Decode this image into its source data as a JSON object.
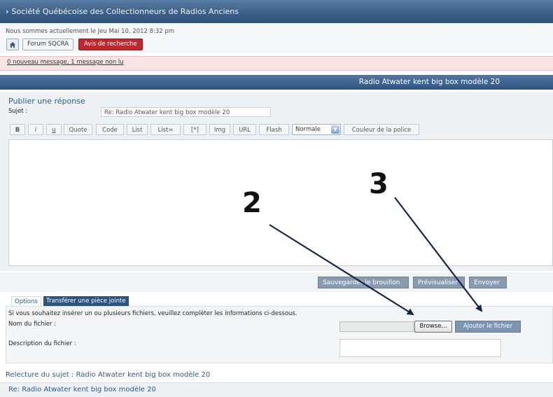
{
  "header": {
    "site_title": "Société Québécoise des Collectionneurs de Radios Anciens"
  },
  "nav": {
    "date_text": "Nous sommes actuellement le Jeu Mai 10, 2012 8:32 pm",
    "home_icon": "home-icon",
    "forum_label": "Forum SQCRA",
    "search_label": "Avis de recherche"
  },
  "notice": {
    "text": "0 nouveau message, 1 message non lu"
  },
  "topic": {
    "title": "Radio Atwater kent big box modèle 20"
  },
  "post": {
    "heading": "Publier une réponse",
    "subject_label": "Sujet :",
    "subject_value": "Re: Radio Atwater kent big box modèle 20",
    "toolbar": [
      "B",
      "i",
      "u",
      "Quote",
      "Code",
      "List",
      "List=",
      "[*]",
      "Img",
      "URL",
      "Flash"
    ],
    "font_size_value": "Normale",
    "font_color_label": "Couleur de la police",
    "message": ""
  },
  "actions": {
    "save_draft": "Sauvegarder le brouillon",
    "preview": "Prévisualiser",
    "submit": "Envoyer"
  },
  "tabs": {
    "options": "Options",
    "attach": "Transférer une pièce jointe"
  },
  "attachment": {
    "info": "Si vous souhaitez insérer un ou plusieurs fichiers, veuillez compléter les informations ci-dessous.",
    "file_name_label": "Nom du fichier :",
    "browse_label": "Browse...",
    "add_file_label": "Ajouter le fichier",
    "description_label": "Description du fichier :"
  },
  "review": {
    "title": "Relecture du sujet : Radio Atwater kent big box modèle 20",
    "post_title": "Re: Radio Atwater kent big box modèle 20"
  },
  "annotations": {
    "label_browse": "2",
    "label_add": "3",
    "arrow_color": "#13254a"
  },
  "colors": {
    "header_blue": "#3c6088",
    "alert_red": "#c4262e",
    "notice_pink": "#f8e4e5",
    "link_blue": "#2c5b8a"
  }
}
